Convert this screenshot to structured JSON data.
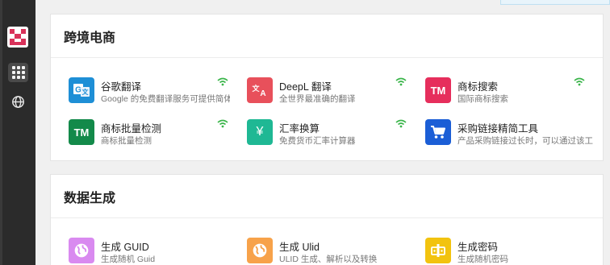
{
  "sidebar": {
    "nav": [
      {
        "icon": "apps-grid-icon"
      },
      {
        "icon": "globe-icon"
      }
    ]
  },
  "sections": [
    {
      "title": "跨境电商",
      "tools": [
        {
          "name": "谷歌翻译",
          "desc": "Google 的免费翻译服务可提供简体",
          "icon": "google-translate-icon",
          "color": "#1e8fd6",
          "signal": true
        },
        {
          "name": "DeepL 翻译",
          "desc": "全世界最准确的翻译",
          "icon": "deepl-translate-icon",
          "color": "#e8505b",
          "signal": true
        },
        {
          "name": "商标搜索",
          "desc": "国际商标搜索",
          "icon": "trademark-icon",
          "glyph": "TM",
          "color": "#e62e5c",
          "signal": true
        },
        {
          "name": "商标批量检测",
          "desc": "商标批量检测",
          "icon": "trademark-icon",
          "glyph": "TM",
          "color": "#138a4a",
          "signal": true
        },
        {
          "name": "汇率换算",
          "desc": "免费货币汇率计算器",
          "icon": "yen-icon",
          "glyph": "¥",
          "color": "#1fb894",
          "signal": true
        },
        {
          "name": "采购链接精简工具",
          "desc": "产品采购链接过长时，可以通过该工",
          "icon": "shopping-cart-icon",
          "color": "#1b5ed6",
          "signal": false
        }
      ]
    },
    {
      "title": "数据生成",
      "tools": [
        {
          "name": "生成 GUID",
          "desc": "生成随机 Guid",
          "icon": "globe-icon",
          "color": "#d98af0",
          "signal": false
        },
        {
          "name": "生成 Ulid",
          "desc": "ULID 生成、解析以及转换",
          "icon": "globe-icon",
          "color": "#f7a24a",
          "signal": false
        },
        {
          "name": "生成密码",
          "desc": "生成随机密码",
          "icon": "password-icon",
          "color": "#f2c30f",
          "signal": false
        }
      ]
    }
  ]
}
